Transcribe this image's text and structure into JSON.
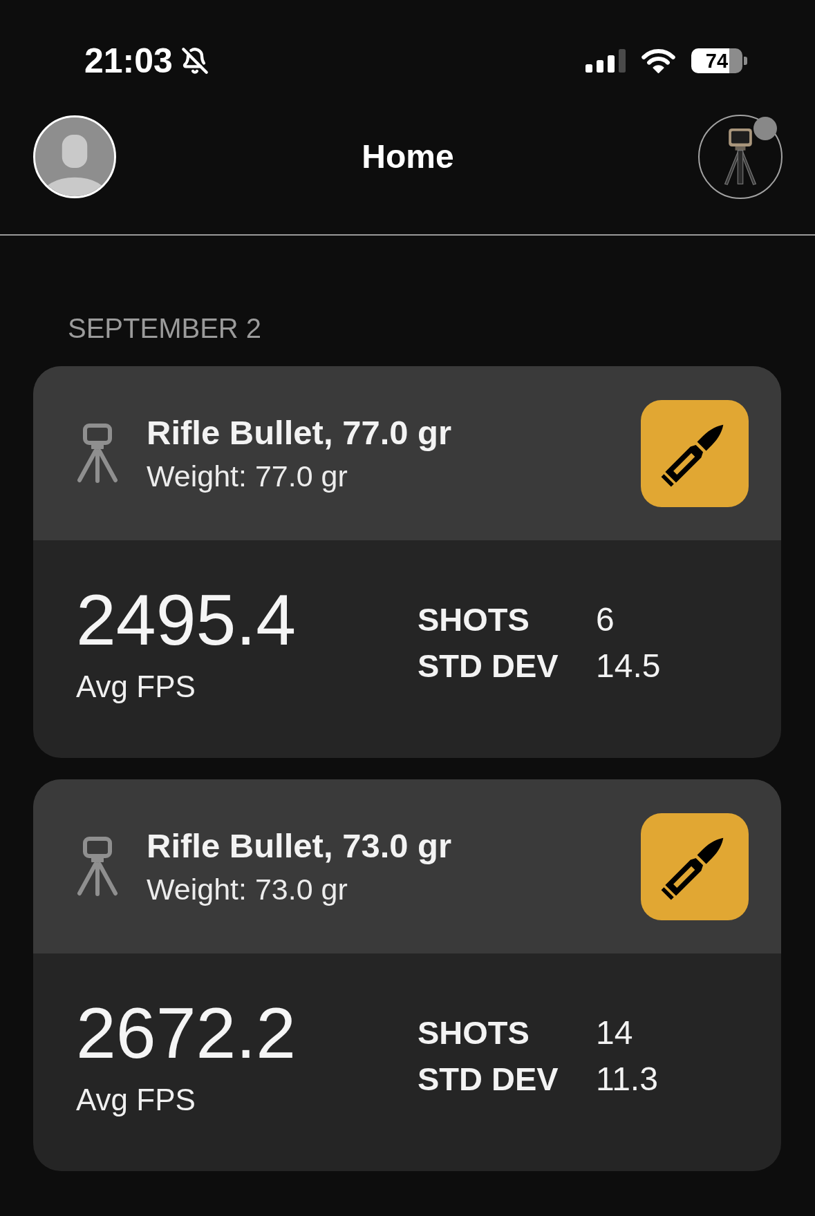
{
  "status_bar": {
    "time": "21:03",
    "silent": true,
    "battery": "74"
  },
  "header": {
    "title": "Home",
    "device": {
      "connected": false
    }
  },
  "date_heading": "SEPTEMBER 2",
  "sessions": [
    {
      "title": "Rifle Bullet, 77.0 gr",
      "subtitle": "Weight: 77.0 gr",
      "average": "2495.4",
      "average_label": "Avg FPS",
      "stats": [
        {
          "label": "SHOTS",
          "value": "6"
        },
        {
          "label": "STD DEV",
          "value": "14.5"
        }
      ]
    },
    {
      "title": "Rifle Bullet, 73.0 gr",
      "subtitle": "Weight: 73.0 gr",
      "average": "2672.2",
      "average_label": "Avg FPS",
      "stats": [
        {
          "label": "SHOTS",
          "value": "14"
        },
        {
          "label": "STD DEV",
          "value": "11.3"
        }
      ]
    }
  ]
}
